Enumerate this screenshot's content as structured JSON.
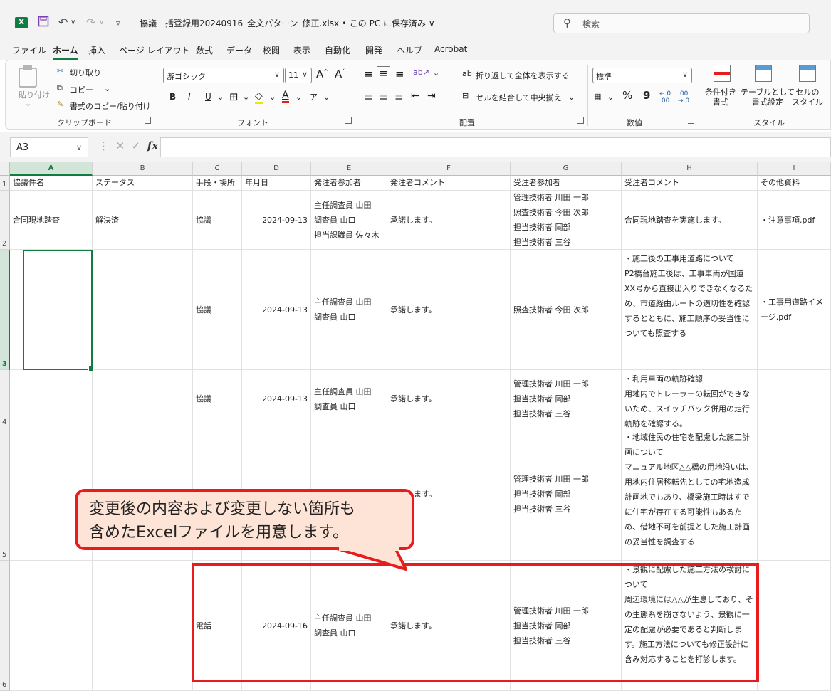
{
  "titlebar": {
    "app_icon": "X",
    "save_icon": "save-icon",
    "undo_icon": "undo-icon",
    "redo_icon": "redo-icon",
    "title": "協議一括登録用20240916_全文パターン_修正.xlsx • この PC に保存済み ∨",
    "search_placeholder": "検索"
  },
  "menu": {
    "tabs": [
      "ファイル",
      "ホーム",
      "挿入",
      "ページ レイアウト",
      "数式",
      "データ",
      "校閲",
      "表示",
      "自動化",
      "開発",
      "ヘルプ",
      "Acrobat"
    ],
    "active_tab": "ホーム"
  },
  "ribbon": {
    "clipboard": {
      "paste": "貼り付け",
      "cut": "切り取り",
      "copy": "コピー",
      "format_painter": "書式のコピー/貼り付け",
      "label": "クリップボード"
    },
    "font": {
      "name": "游ゴシック",
      "size": "11",
      "bold": "B",
      "italic": "I",
      "underline": "U",
      "label": "フォント"
    },
    "alignment": {
      "wrap": "折り返して全体を表示する",
      "merge": "セルを結合して中央揃え",
      "label": "配置"
    },
    "number": {
      "format": "標準",
      "percent": "%",
      "comma": "9",
      "label": "数値"
    },
    "styles": {
      "conditional": "条件付き\n書式",
      "table": "テーブルとして\n書式設定",
      "cell": "セルの\nスタイル",
      "label": "スタイル"
    }
  },
  "formula_bar": {
    "name_box": "A3",
    "fx": "fx",
    "value": ""
  },
  "grid": {
    "columns": [
      "A",
      "B",
      "C",
      "D",
      "E",
      "F",
      "G",
      "H",
      "I"
    ],
    "rows": [
      "1",
      "2",
      "3",
      "4",
      "5",
      "6"
    ],
    "header_row": [
      "協議件名",
      "ステータス",
      "手段・場所",
      "年月日",
      "発注者参加者",
      "発注者コメント",
      "受注者参加者",
      "受注者コメント",
      "その他資料"
    ],
    "data": [
      [
        "合同現地踏査",
        "解決済",
        "協議",
        "2024-09-13",
        "主任調査員 山田\n調査員 山口\n担当課職員 佐々木",
        "承諾します。",
        "管理技術者 川田 一郎\n照査技術者 今田 次郎\n担当技術者 岡部\n担当技術者 三谷",
        "合同現地踏査を実施します。",
        "・注意事項.pdf"
      ],
      [
        "",
        "",
        "協議",
        "2024-09-13",
        "主任調査員 山田\n調査員 山口",
        "承諾します。",
        "照査技術者 今田 次郎",
        "・施工後の工事用道路について\nP2橋台施工後は、工事車両が国道XX号から直接出入りできなくなるため、市道経由ルートの適切性を確認するとともに、施工順序の妥当性についても照査する",
        "・工事用道路イメージ.pdf"
      ],
      [
        "",
        "",
        "協議",
        "2024-09-13",
        "主任調査員 山田\n調査員 山口",
        "承諾します。",
        "管理技術者 川田 一郎\n担当技術者 岡部\n担当技術者 三谷",
        "・利用車両の軌跡確認\n用地内でトレーラーの転回ができないため、スイッチバック併用の走行軌跡を確認する。",
        ""
      ],
      [
        "",
        "",
        "",
        "",
        "主任調査員 山田",
        "承諾します。",
        "管理技術者 川田 一郎\n担当技術者 岡部\n担当技術者 三谷",
        "・地域住民の住宅を配慮した施工計画について\nマニュアル地区△△橋の用地沿いは、用地内住居移転先としての宅地造成計画地でもあり、橋梁施工時はすでに住宅が存在する可能性もあるため、借地不可を前提とした施工計画の妥当性を調査する",
        ""
      ],
      [
        "",
        "",
        "電話",
        "2024-09-16",
        "主任調査員 山田\n調査員 山口",
        "承諾します。",
        "管理技術者 川田 一郎\n担当技術者 岡部\n担当技術者 三谷",
        "・景観に配慮した施工方法の検討について\n周辺環境には△△が生息しており、その生態系を崩さないよう、景観に一定の配慮が必要であると判断します。施工方法についても修正設計に含み対応することを打診します。",
        ""
      ]
    ]
  },
  "callout": {
    "text": "変更後の内容および変更しない箇所も\n含めたExcelファイルを用意します。"
  }
}
